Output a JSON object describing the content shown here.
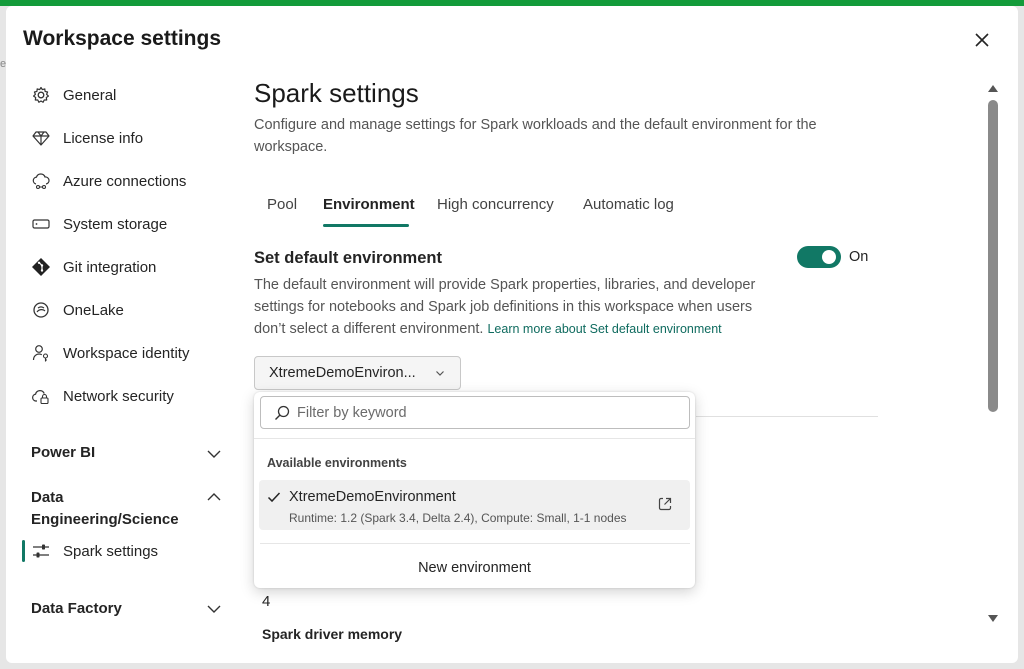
{
  "background_fragment": "e",
  "dialog": {
    "title": "Workspace settings",
    "close_icon": "close-icon"
  },
  "sidebar": {
    "items": [
      {
        "label": "General",
        "icon": "gear-icon"
      },
      {
        "label": "License info",
        "icon": "diamond-icon"
      },
      {
        "label": "Azure connections",
        "icon": "cloud-link-icon"
      },
      {
        "label": "System storage",
        "icon": "storage-icon"
      },
      {
        "label": "Git integration",
        "icon": "git-icon"
      },
      {
        "label": "OneLake",
        "icon": "onelake-icon"
      },
      {
        "label": "Workspace identity",
        "icon": "identity-icon"
      },
      {
        "label": "Network security",
        "icon": "cloud-lock-icon"
      }
    ],
    "sections": [
      {
        "label": "Power BI",
        "expanded": false
      },
      {
        "label": "Data Engineering/Science",
        "line1": "Data",
        "line2": "Engineering/Science",
        "expanded": true
      },
      {
        "label": "Data Factory",
        "expanded": false
      }
    ],
    "active_item": {
      "label": "Spark settings",
      "icon": "sliders-icon"
    },
    "accent_color": "#117865"
  },
  "main": {
    "title": "Spark settings",
    "description": "Configure and manage settings for Spark workloads and the default environment for the workspace.",
    "tabs": [
      {
        "label": "Pool",
        "active": false
      },
      {
        "label": "Environment",
        "active": true
      },
      {
        "label": "High concurrency",
        "active": false
      },
      {
        "label": "Automatic log",
        "active": false
      }
    ],
    "default_env": {
      "title": "Set default environment",
      "description": "The default environment will provide Spark properties, libraries, and developer settings for notebooks and Spark job definitions in this workspace when users don’t select a different environment.",
      "learn_more": "Learn more about Set default environment",
      "toggle_state": "On",
      "toggle_color": "#117865"
    },
    "env_select": {
      "value": "XtremeDemoEnviron...",
      "icon": "chevron-down-icon"
    },
    "background_value": "4",
    "background_cut_label": "Spark driver memory"
  },
  "dropdown": {
    "filter_placeholder": "Filter by keyword",
    "filter_icon": "search-icon",
    "section_header": "Available environments",
    "options": [
      {
        "name": "XtremeDemoEnvironment",
        "details": "Runtime: 1.2 (Spark 3.4, Delta 2.4), Compute: Small, 1-1 nodes",
        "selected": true,
        "icon": "open-external-icon"
      }
    ],
    "new_env_label": "New environment"
  }
}
